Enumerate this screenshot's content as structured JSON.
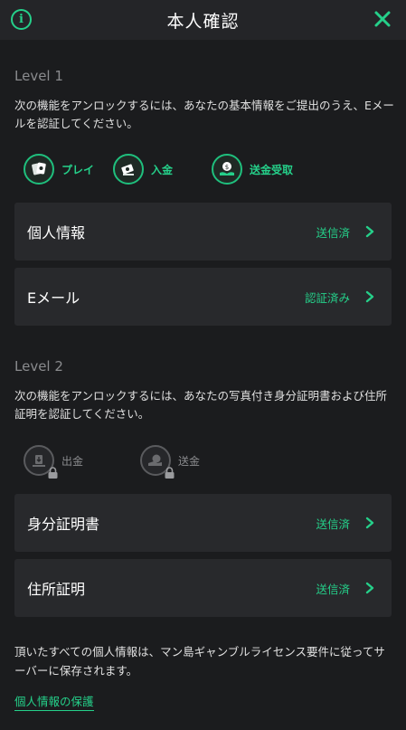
{
  "header": {
    "title": "本人確認",
    "info_icon": "info-icon",
    "close_icon": "close-icon"
  },
  "level1": {
    "title": "Level 1",
    "description": "次の機能をアンロックするには、あなたの基本情報をご提出のうえ、Eメールを認証してください。",
    "features": [
      {
        "label": "プレイ",
        "icon": "cards-icon"
      },
      {
        "label": "入金",
        "icon": "deposit-icon"
      },
      {
        "label": "送金受取",
        "icon": "receive-money-icon"
      }
    ],
    "rows": [
      {
        "label": "個人情報",
        "status": "送信済"
      },
      {
        "label": "Eメール",
        "status": "認証済み"
      }
    ]
  },
  "level2": {
    "title": "Level 2",
    "description": "次の機能をアンロックするには、あなたの写真付き身分証明書および住所証明を認証してください。",
    "features": [
      {
        "label": "出金",
        "icon": "withdraw-icon"
      },
      {
        "label": "送金",
        "icon": "send-money-icon"
      }
    ],
    "rows": [
      {
        "label": "身分証明書",
        "status": "送信済"
      },
      {
        "label": "住所証明",
        "status": "送信済"
      }
    ]
  },
  "footer": {
    "text": "頂いたすべての個人情報は、マン島ギャンブルライセンス要件に従ってサーバーに保存されます。",
    "link": "個人情報の保護"
  },
  "colors": {
    "accent": "#25d08a",
    "background": "#1b1c1e",
    "card": "#28292c",
    "muted": "#8a8b8e"
  }
}
